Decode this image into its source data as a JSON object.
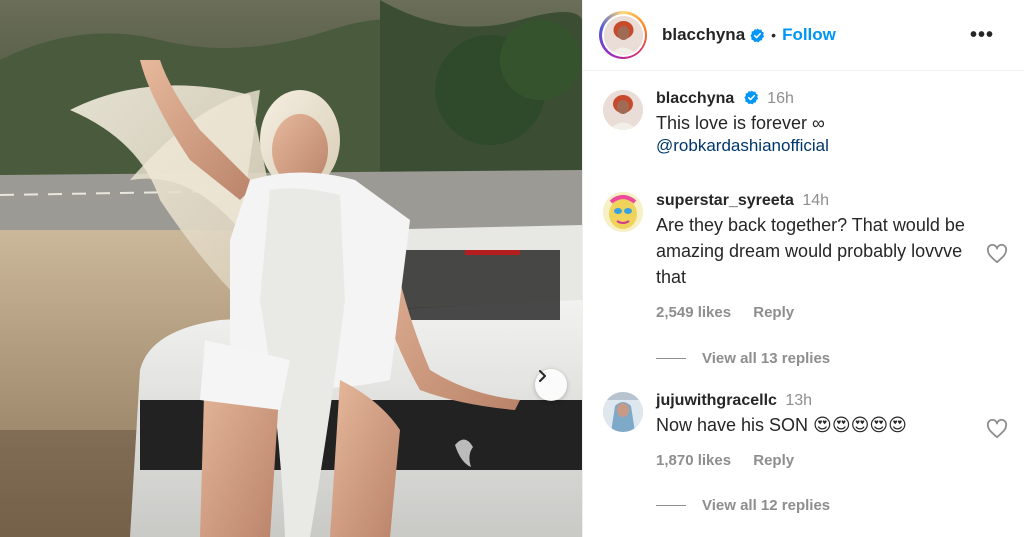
{
  "post": {
    "author": "blacchyna",
    "follow_label": "Follow",
    "dot": "•",
    "more_icon": "more-horizontal-icon"
  },
  "caption": {
    "username": "blacchyna",
    "time": "16h",
    "text": "This love is forever ∞",
    "mention": "@robkardashianofficial"
  },
  "comments": [
    {
      "username": "superstar_syreeta",
      "time": "14h",
      "text": "Are they back together? That would be amazing dream would probably lovvve that",
      "likes": "2,549 likes",
      "reply_label": "Reply",
      "view_replies": "View all 13 replies"
    },
    {
      "username": "jujuwithgracellc",
      "time": "13h",
      "text": "Now have his SON 😍😍😍😍😍",
      "likes": "1,870 likes",
      "reply_label": "Reply",
      "view_replies": "View all 12 replies"
    }
  ],
  "colors": {
    "accent": "#0095f6",
    "verified": "#0095f6",
    "muted": "#8e8e8e"
  }
}
